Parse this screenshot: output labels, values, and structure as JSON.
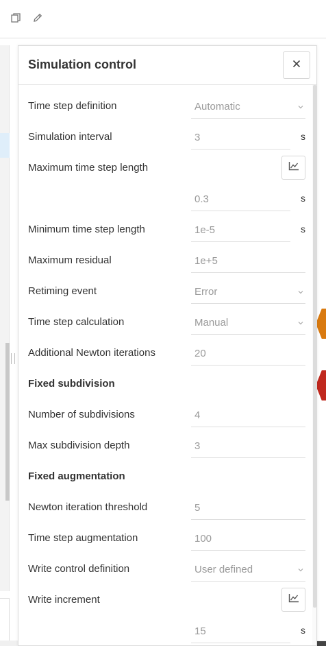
{
  "toolbar": {
    "copy_icon": "copy-icon",
    "edit_icon": "pencil-icon"
  },
  "panel": {
    "title": "Simulation control",
    "close_icon": "close-icon"
  },
  "rows": {
    "time_step_definition": {
      "label": "Time step definition",
      "value": "Automatic"
    },
    "simulation_interval": {
      "label": "Simulation interval",
      "value": "3",
      "unit": "s"
    },
    "max_time_step_length": {
      "label": "Maximum time step length",
      "value": "0.3",
      "unit": "s"
    },
    "min_time_step_length": {
      "label": "Minimum time step length",
      "value": "1e-5",
      "unit": "s"
    },
    "max_residual": {
      "label": "Maximum residual",
      "value": "1e+5"
    },
    "retiming_event": {
      "label": "Retiming event",
      "value": "Error"
    },
    "time_step_calculation": {
      "label": "Time step calculation",
      "value": "Manual"
    },
    "additional_newton_iterations": {
      "label": "Additional Newton iterations",
      "value": "20"
    },
    "fixed_subdivision": {
      "label": "Fixed subdivision"
    },
    "number_of_subdivisions": {
      "label": "Number of subdivisions",
      "value": "4"
    },
    "max_subdivision_depth": {
      "label": "Max subdivision depth",
      "value": "3"
    },
    "fixed_augmentation": {
      "label": "Fixed augmentation"
    },
    "newton_iteration_threshold": {
      "label": "Newton iteration threshold",
      "value": "5"
    },
    "time_step_augmentation": {
      "label": "Time step augmentation",
      "value": "100"
    },
    "write_control_definition": {
      "label": "Write control definition",
      "value": "User defined"
    },
    "write_increment": {
      "label": "Write increment",
      "value": "15",
      "unit": "s"
    }
  },
  "colors": {
    "accent_orange": "#d97a10",
    "accent_red": "#c0281e"
  }
}
